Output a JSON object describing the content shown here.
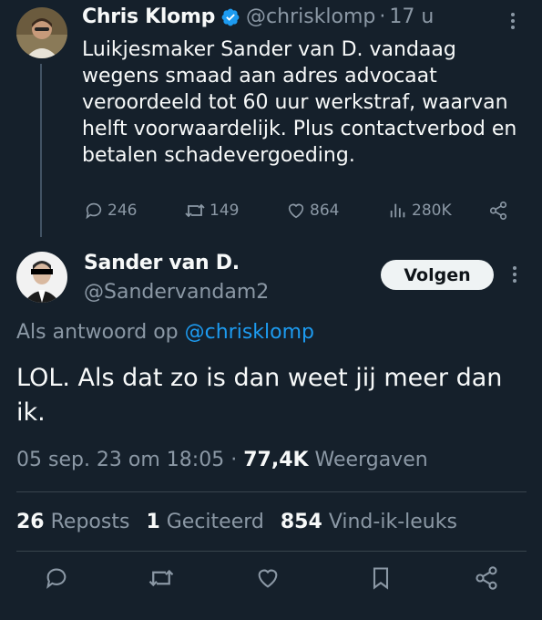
{
  "tweet1": {
    "name": "Chris Klomp",
    "handle": "@chrisklomp",
    "dot": "·",
    "time": "17 u",
    "text": "Luikjesmaker Sander van D. vandaag wegens smaad aan adres advocaat veroordeeld tot 60 uur werkstraf, waarvan helft voorwaardelijk. Plus contactverbod en betalen schadevergoeding.",
    "replies": "246",
    "reposts": "149",
    "likes": "864",
    "views": "280K"
  },
  "tweet2": {
    "name": "Sander van D.",
    "handle": "@Sandervandam2",
    "follow_label": "Volgen",
    "reply_prefix": "Als antwoord op",
    "reply_handle": "@chrisklomp",
    "text": "LOL. Als dat zo is dan weet jij meer dan ik.",
    "date": "05 sep. 23 om 18:05",
    "dot": "·",
    "views_count": "77,4K",
    "views_label": "Weergaven",
    "reposts_count": "26",
    "reposts_label": "Reposts",
    "quotes_count": "1",
    "quotes_label": "Geciteerd",
    "likes_count": "854",
    "likes_label": "Vind-ik-leuks"
  },
  "colors": {
    "background": "#15202b",
    "text": "#f7f9f9",
    "muted": "#8b98a5",
    "link": "#1d9bf0",
    "verified": "#1d9bf0",
    "divider": "#38444d"
  },
  "icons": {
    "reply": "reply-icon",
    "repost": "repost-icon",
    "like": "heart-icon",
    "views": "views-icon",
    "share": "share-icon",
    "bookmark": "bookmark-icon",
    "more": "more-icon",
    "verified": "verified-badge-icon"
  }
}
